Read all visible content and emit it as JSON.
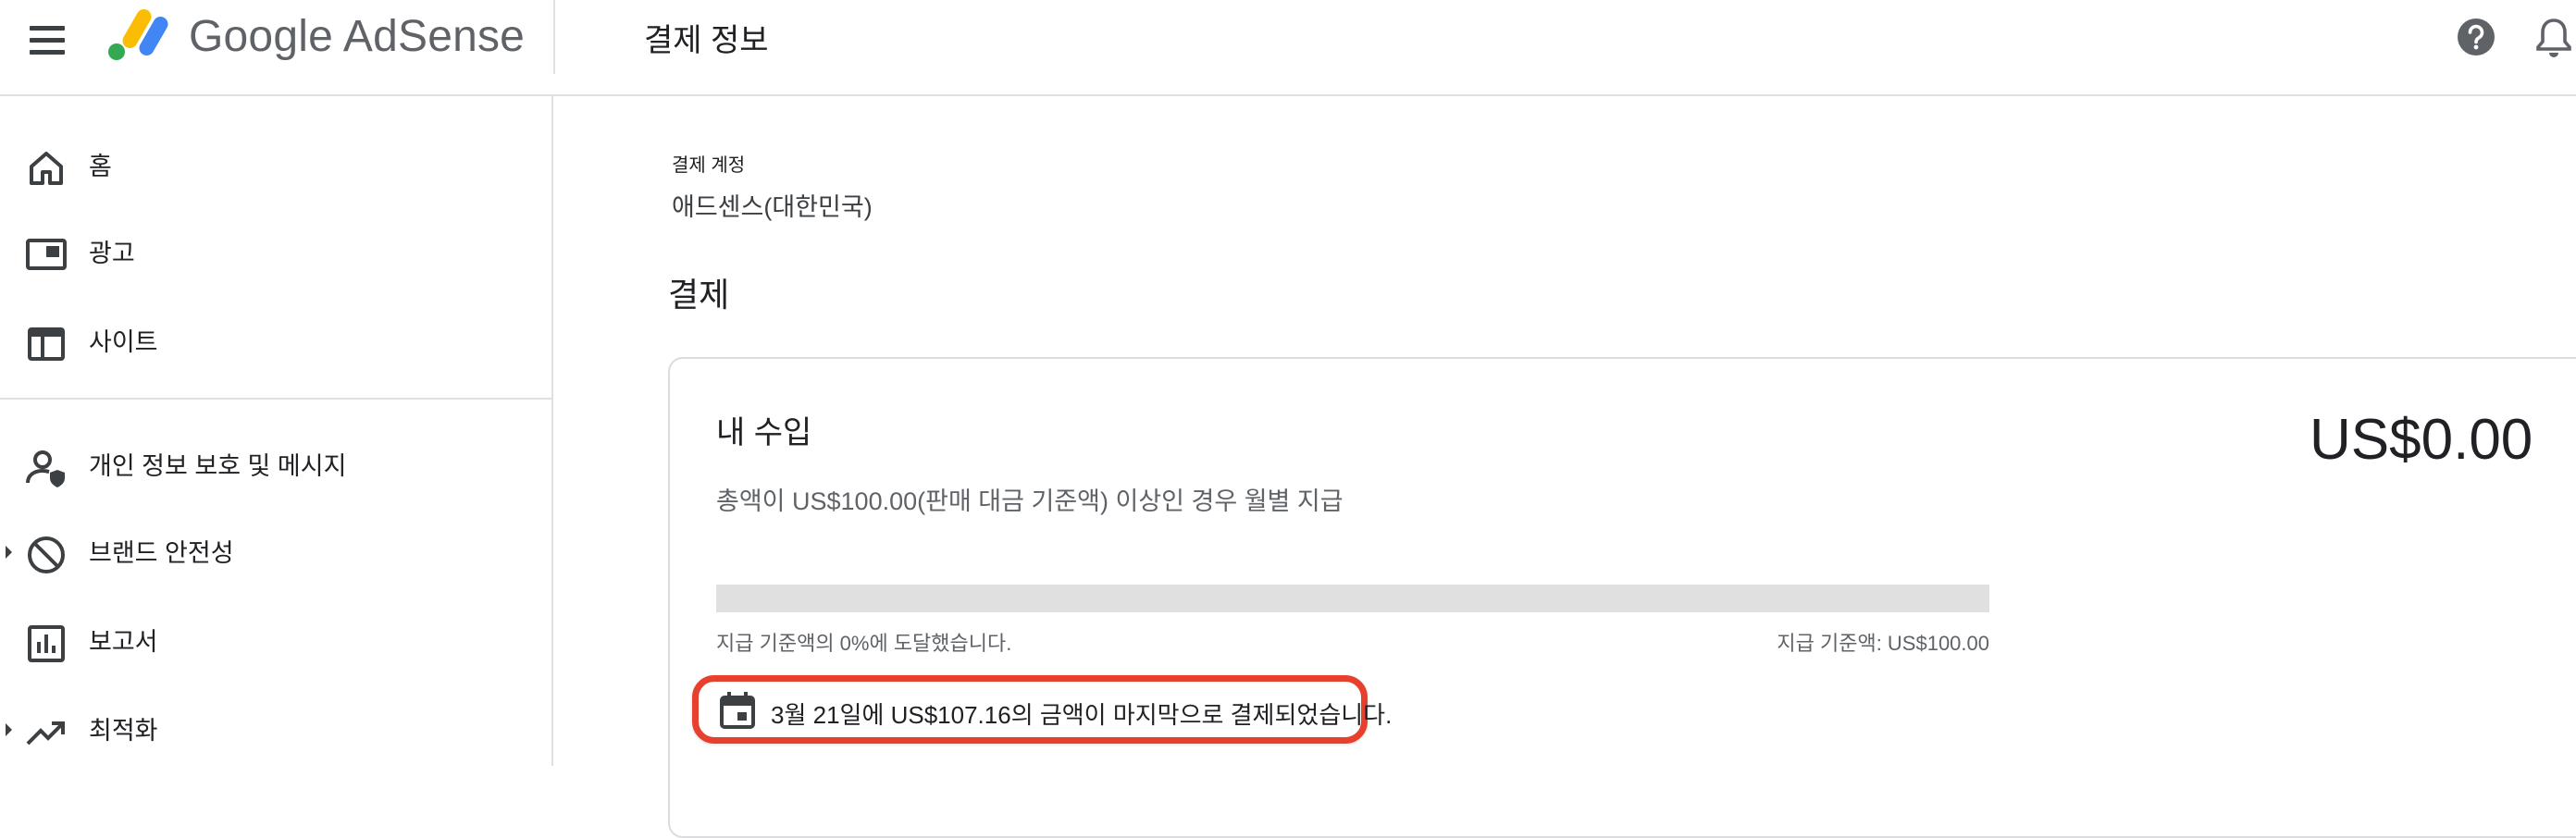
{
  "header": {
    "brand": "Google AdSense",
    "page_title": "결제 정보"
  },
  "sidebar": {
    "items": [
      {
        "label": "홈",
        "icon": "home-icon"
      },
      {
        "label": "광고",
        "icon": "ads-icon"
      },
      {
        "label": "사이트",
        "icon": "sites-icon"
      },
      {
        "label": "개인 정보 보호 및 메시지",
        "icon": "privacy-messaging-icon"
      },
      {
        "label": "브랜드 안전성",
        "icon": "block-icon"
      },
      {
        "label": "보고서",
        "icon": "reports-icon"
      },
      {
        "label": "최적화",
        "icon": "trending-up-icon"
      }
    ]
  },
  "main": {
    "payments_account_label": "결제 계정",
    "payments_account_value": "애드센스(대한민국)",
    "section_title": "결제",
    "earnings_card": {
      "title": "내 수입",
      "amount": "US$0.00",
      "description": "총액이 US$100.00(판매 대금 기준액) 이상인 경우 월별 지급",
      "progress_percent": 0,
      "progress_left_text": "지급 기준액의 0%에 도달했습니다.",
      "progress_right_text": "지급 기준액: US$100.00",
      "last_payment_text": "3월 21일에 US$107.16의 금액이 마지막으로 결제되었습니다."
    }
  },
  "colors": {
    "highlight_border": "#e8402f",
    "progress_track": "#e0e0e0",
    "logo_yellow": "#fbbc04",
    "logo_blue": "#4285f4",
    "logo_green": "#34a853"
  }
}
